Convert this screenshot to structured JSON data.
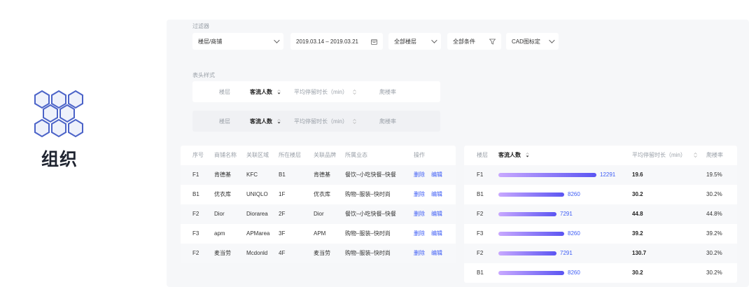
{
  "brand": {
    "title": "组织",
    "icon": "hexagon-cluster-icon",
    "color": "#4b63c8"
  },
  "filters": {
    "label": "过滤器",
    "items": [
      {
        "text": "楼层/商铺",
        "icon": "chevron-down-icon"
      },
      {
        "text": "2019.03.14 – 2019.03.21",
        "icon": "calendar-icon"
      },
      {
        "text": "全部楼层",
        "icon": "chevron-down-icon"
      },
      {
        "text": "全部条件",
        "icon": "filter-icon"
      },
      {
        "text": "CAD图标定",
        "icon": "chevron-down-icon"
      }
    ]
  },
  "header_style": {
    "label": "表头样式",
    "columns": [
      "楼层",
      "客流人数",
      "平均停留时长（min）",
      "爬楼率"
    ]
  },
  "left_table": {
    "headers": [
      "序号",
      "商铺名称",
      "关联区域",
      "所在楼层",
      "关联品牌",
      "所属业态",
      "操作"
    ],
    "delete_label": "删除",
    "edit_label": "编辑",
    "rows": [
      [
        "F1",
        "肯德基",
        "KFC",
        "B1",
        "肯德基",
        "餐饮–小吃快餐–快餐"
      ],
      [
        "B1",
        "优衣库",
        "UNIQLO",
        "1F",
        "优衣库",
        "购物–服装–快时尚"
      ],
      [
        "F2",
        "Dior",
        "Diorarea",
        "2F",
        "Dior",
        "餐饮–小吃快餐–快餐"
      ],
      [
        "F3",
        "apm",
        "APMarea",
        "3F",
        "APM",
        "购物–服装–快时尚"
      ],
      [
        "F2",
        "麦当劳",
        "Mcdonld",
        "4F",
        "麦当劳",
        "购物–服装–快时尚"
      ]
    ]
  },
  "right_table": {
    "headers": [
      "楼层",
      "客流人数",
      "平均停留时长（min）",
      "爬楼率"
    ],
    "max_value": 12291,
    "rows": [
      {
        "floor": "F1",
        "visitors": 12291,
        "visitors_label": "12291",
        "stay": "19.6",
        "rate": "19.5%"
      },
      {
        "floor": "B1",
        "visitors": 8260,
        "visitors_label": "8260",
        "stay": "30.2",
        "rate": "30.2%"
      },
      {
        "floor": "F2",
        "visitors": 7291,
        "visitors_label": "7291",
        "stay": "44.8",
        "rate": "44.8%"
      },
      {
        "floor": "F3",
        "visitors": 8260,
        "visitors_label": "8260",
        "stay": "39.2",
        "rate": "39.2%"
      },
      {
        "floor": "F2",
        "visitors": 7291,
        "visitors_label": "7291",
        "stay": "130.7",
        "rate": "30.2%"
      },
      {
        "floor": "B1",
        "visitors": 8260,
        "visitors_label": "8260",
        "stay": "30.2",
        "rate": "30.2%"
      }
    ]
  }
}
